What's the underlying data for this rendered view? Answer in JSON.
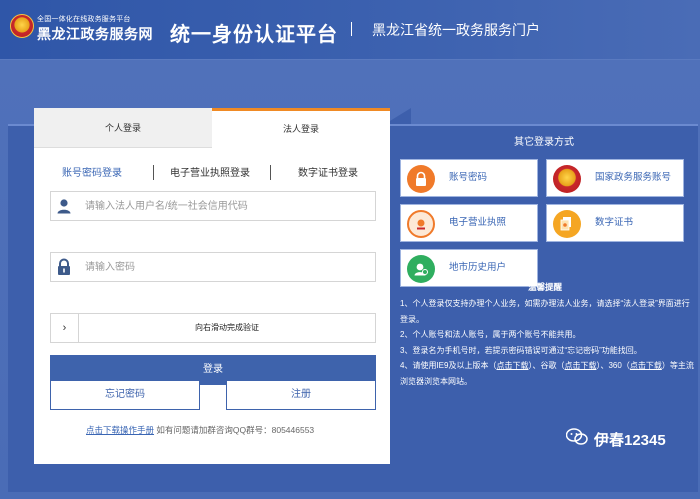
{
  "header": {
    "brand_small": "全国一体化在线政务服务平台",
    "brand_big": "黑龙江政务服务网",
    "site_title": "统一身份认证平台",
    "portal_title": "黑龙江省统一政务服务门户"
  },
  "tabs": {
    "personal": "个人登录",
    "legal": "法人登录",
    "active": "legal"
  },
  "subtabs": {
    "account": "账号密码登录",
    "license": "电子营业执照登录",
    "cert": "数字证书登录"
  },
  "form": {
    "username_placeholder": "请输入法人用户名/统一社会信用代码",
    "password_placeholder": "请输入密码",
    "slider_text": "向右滑动完成验证",
    "login_label": "登录",
    "forgot_label": "忘记密码",
    "register_label": "注册"
  },
  "help": {
    "link": "点击下载操作手册",
    "text": "如有问题请加群咨询QQ群号：805446553"
  },
  "other_logins": {
    "title": "其它登录方式",
    "methods": [
      {
        "label": "账号密码",
        "icon": "lock-icon"
      },
      {
        "label": "国家政务服务账号",
        "icon": "national-emblem-icon"
      },
      {
        "label": "电子营业执照",
        "icon": "license-icon"
      },
      {
        "label": "数字证书",
        "icon": "certificate-icon"
      },
      {
        "label": "地市历史用户",
        "icon": "user-icon"
      }
    ]
  },
  "tips": {
    "title": "温馨提醒",
    "line1": "1、个人登录仅支持办理个人业务，如需办理法人业务，请选择“法人登录”界面进行登录。",
    "line2": "2、个人账号和法人账号，属于两个账号不能共用。",
    "line3": "3、登录名为手机号时，若提示密码错误可通过“忘记密码”功能找回。",
    "line4_a": "4、请使用IE9及以上版本（",
    "line4_link1": "点击下载",
    "line4_b": "）、谷歌（",
    "line4_link2": "点击下载",
    "line4_c": "）、360（",
    "line4_link3": "点击下载",
    "line4_d": "）等主流浏览器浏览本网站。"
  },
  "watermark": "伊春12345",
  "colors": {
    "primary": "#3e63ac",
    "accent_tab": "#f08a24",
    "background": "#4f70b8",
    "icon_orange": "#f07a2a",
    "icon_green": "#2fae5f"
  }
}
